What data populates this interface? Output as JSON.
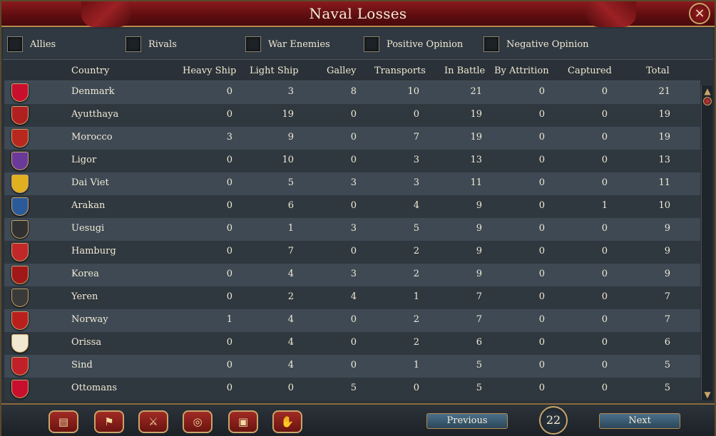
{
  "window": {
    "title": "Naval Losses",
    "close_icon": "×"
  },
  "filters": [
    {
      "label": "Allies"
    },
    {
      "label": "Rivals"
    },
    {
      "label": "War Enemies"
    },
    {
      "label": "Positive Opinion"
    },
    {
      "label": "Negative Opinion"
    }
  ],
  "columns": {
    "country": "Country",
    "heavy_ship": "Heavy Ship",
    "light_ship": "Light Ship",
    "galley": "Galley",
    "transports": "Transports",
    "in_battle": "In Battle",
    "by_attrition": "By Attrition",
    "captured": "Captured",
    "total": "Total"
  },
  "rows": [
    {
      "country": "Denmark",
      "flag_color": "#c8102e",
      "flag_icon": "cross-flag",
      "heavy": "0",
      "light": "3",
      "galley": "8",
      "transports": "10",
      "in_battle": "21",
      "attrition": "0",
      "captured": "0",
      "total": "21"
    },
    {
      "country": "Ayutthaya",
      "flag_color": "#b02020",
      "flag_icon": "elephant-flag",
      "heavy": "0",
      "light": "19",
      "galley": "0",
      "transports": "0",
      "in_battle": "19",
      "attrition": "0",
      "captured": "0",
      "total": "19"
    },
    {
      "country": "Morocco",
      "flag_color": "#b8281f",
      "flag_icon": "star-flag",
      "heavy": "3",
      "light": "9",
      "galley": "0",
      "transports": "7",
      "in_battle": "19",
      "attrition": "0",
      "captured": "0",
      "total": "19"
    },
    {
      "country": "Ligor",
      "flag_color": "#6a3a9a",
      "flag_icon": "crest-flag",
      "heavy": "0",
      "light": "10",
      "galley": "0",
      "transports": "3",
      "in_battle": "13",
      "attrition": "0",
      "captured": "0",
      "total": "13"
    },
    {
      "country": "Dai Viet",
      "flag_color": "#e0b020",
      "flag_icon": "circle-flag",
      "heavy": "0",
      "light": "5",
      "galley": "3",
      "transports": "3",
      "in_battle": "11",
      "attrition": "0",
      "captured": "0",
      "total": "11"
    },
    {
      "country": "Arakan",
      "flag_color": "#2a5a9a",
      "flag_icon": "stripes-flag",
      "heavy": "0",
      "light": "6",
      "galley": "0",
      "transports": "4",
      "in_battle": "9",
      "attrition": "0",
      "captured": "1",
      "total": "10"
    },
    {
      "country": "Uesugi",
      "flag_color": "#303030",
      "flag_icon": "mon-flag",
      "heavy": "0",
      "light": "1",
      "galley": "3",
      "transports": "5",
      "in_battle": "9",
      "attrition": "0",
      "captured": "0",
      "total": "9"
    },
    {
      "country": "Hamburg",
      "flag_color": "#c0282a",
      "flag_icon": "castle-flag",
      "heavy": "0",
      "light": "7",
      "galley": "0",
      "transports": "2",
      "in_battle": "9",
      "attrition": "0",
      "captured": "0",
      "total": "9"
    },
    {
      "country": "Korea",
      "flag_color": "#a01818",
      "flag_icon": "emblem-flag",
      "heavy": "0",
      "light": "4",
      "galley": "3",
      "transports": "2",
      "in_battle": "9",
      "attrition": "0",
      "captured": "0",
      "total": "9"
    },
    {
      "country": "Yeren",
      "flag_color": "#3a3a3a",
      "flag_icon": "mon-flag",
      "heavy": "0",
      "light": "2",
      "galley": "4",
      "transports": "1",
      "in_battle": "7",
      "attrition": "0",
      "captured": "0",
      "total": "7"
    },
    {
      "country": "Norway",
      "flag_color": "#b8201e",
      "flag_icon": "lion-flag",
      "heavy": "1",
      "light": "4",
      "galley": "0",
      "transports": "2",
      "in_battle": "7",
      "attrition": "0",
      "captured": "0",
      "total": "7"
    },
    {
      "country": "Orissa",
      "flag_color": "#f0e8d0",
      "flag_icon": "sun-flag",
      "heavy": "0",
      "light": "4",
      "galley": "0",
      "transports": "2",
      "in_battle": "6",
      "attrition": "0",
      "captured": "0",
      "total": "6"
    },
    {
      "country": "Sind",
      "flag_color": "#c02028",
      "flag_icon": "stripes-flag",
      "heavy": "0",
      "light": "4",
      "galley": "0",
      "transports": "1",
      "in_battle": "5",
      "attrition": "0",
      "captured": "0",
      "total": "5"
    },
    {
      "country": "Ottomans",
      "flag_color": "#c8102e",
      "flag_icon": "crescent-flag",
      "heavy": "0",
      "light": "0",
      "galley": "5",
      "transports": "0",
      "in_battle": "5",
      "attrition": "0",
      "captured": "0",
      "total": "5"
    }
  ],
  "bottom": {
    "tabs": [
      {
        "icon": "ledger-icon"
      },
      {
        "icon": "flag-icon"
      },
      {
        "icon": "crossed-swords-icon"
      },
      {
        "icon": "coins-icon"
      },
      {
        "icon": "crate-icon"
      },
      {
        "icon": "handshake-icon"
      }
    ],
    "previous_label": "Previous",
    "next_label": "Next",
    "page": "22"
  }
}
